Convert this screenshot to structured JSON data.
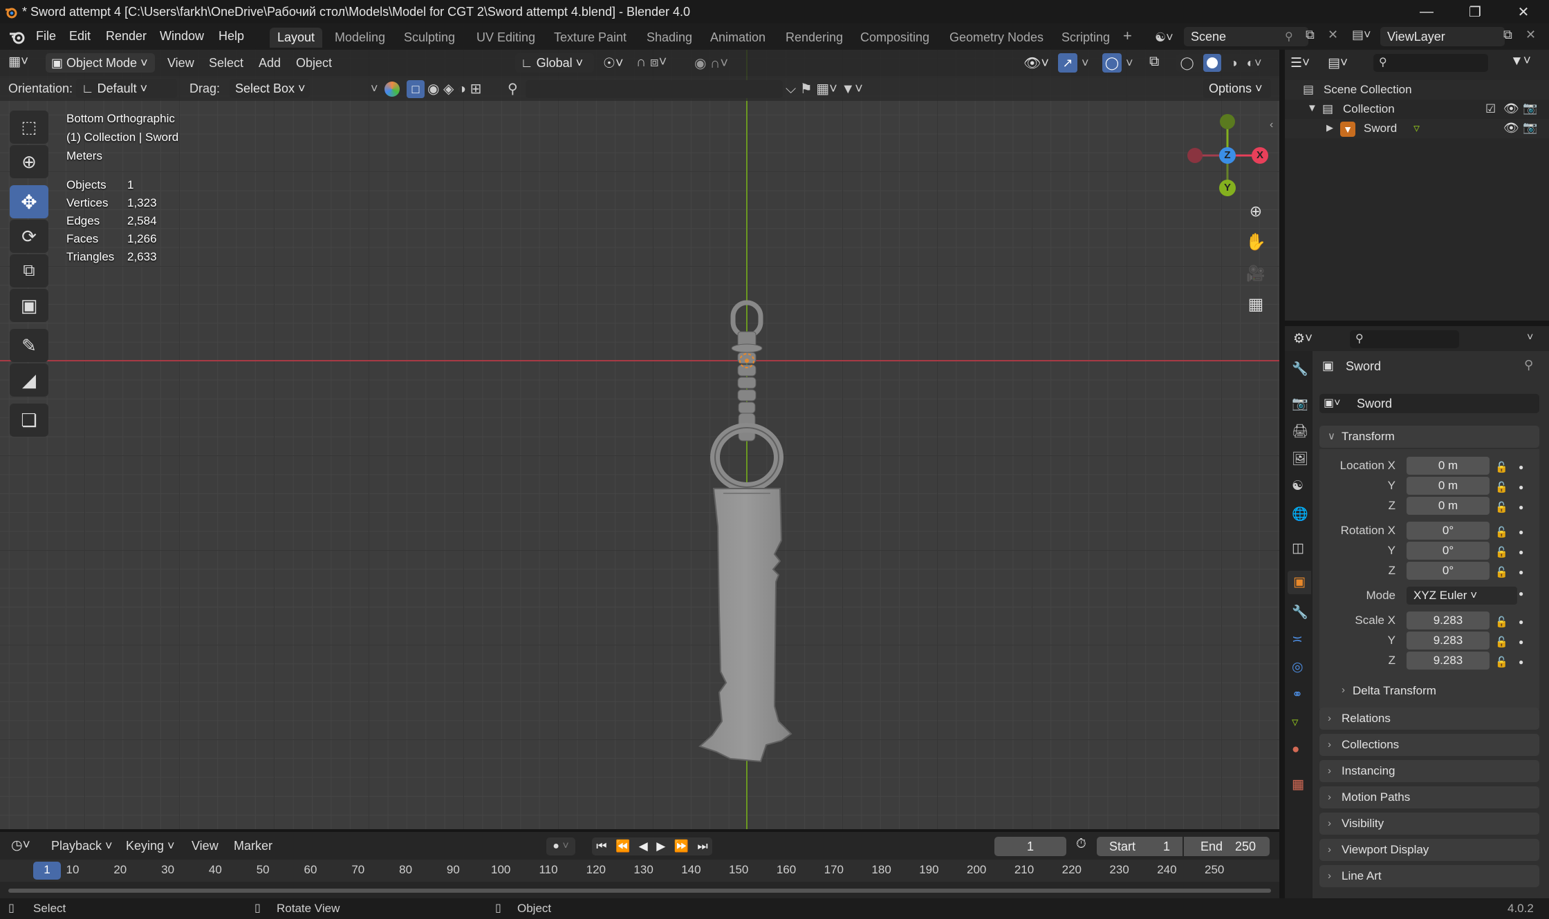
{
  "title_bar": {
    "title": "* Sword attempt 4 [C:\\Users\\farkh\\OneDrive\\Рабочий стол\\Models\\Model for CGT 2\\Sword attempt 4.blend] - Blender 4.0"
  },
  "menu": {
    "file": "File",
    "edit": "Edit",
    "render": "Render",
    "window": "Window",
    "help": "Help"
  },
  "workspaces": [
    "Layout",
    "Modeling",
    "Sculpting",
    "UV Editing",
    "Texture Paint",
    "Shading",
    "Animation",
    "Rendering",
    "Compositing",
    "Geometry Nodes",
    "Scripting"
  ],
  "active_workspace": "Layout",
  "scene": {
    "name": "Scene",
    "view_layer": "ViewLayer"
  },
  "viewport_header": {
    "mode": "Object Mode",
    "view": "View",
    "select": "Select",
    "add": "Add",
    "object": "Object",
    "transform_orientation": "Global"
  },
  "tool_header": {
    "orientation_label": "Orientation:",
    "orientation_value": "Default",
    "drag_label": "Drag:",
    "drag_value": "Select Box",
    "options": "Options"
  },
  "overlay_text": {
    "view_name": "Bottom Orthographic",
    "collection_info": "(1) Collection | Sword",
    "units": "Meters"
  },
  "stats": [
    {
      "label": "Objects",
      "value": "1"
    },
    {
      "label": "Vertices",
      "value": "1,323"
    },
    {
      "label": "Edges",
      "value": "2,584"
    },
    {
      "label": "Faces",
      "value": "1,266"
    },
    {
      "label": "Triangles",
      "value": "2,633"
    }
  ],
  "gizmo": {
    "x": "X",
    "y": "Y",
    "z": "Z"
  },
  "outliner": {
    "root": "Scene Collection",
    "collection": "Collection",
    "object": "Sword"
  },
  "properties": {
    "object_name": "Sword",
    "data_name": "Sword",
    "transform_title": "Transform",
    "location": {
      "label": "Location X",
      "x": "0 m",
      "y": "0 m",
      "z": "0 m"
    },
    "rotation": {
      "label": "Rotation X",
      "x": "0°",
      "y": "0°",
      "z": "0°"
    },
    "mode": {
      "label": "Mode",
      "value": "XYZ Euler"
    },
    "scale": {
      "label": "Scale X",
      "x": "9.283",
      "y": "9.283",
      "z": "9.283"
    },
    "axis_y": "Y",
    "axis_z": "Z",
    "delta_transform": "Delta Transform",
    "panels": [
      "Relations",
      "Collections",
      "Instancing",
      "Motion Paths",
      "Visibility",
      "Viewport Display",
      "Line Art"
    ]
  },
  "timeline": {
    "playback": "Playback",
    "keying": "Keying",
    "view": "View",
    "marker": "Marker",
    "current_frame": "1",
    "start_label": "Start",
    "start": "1",
    "end_label": "End",
    "end": "250",
    "ruler": [
      "1",
      "10",
      "20",
      "30",
      "40",
      "50",
      "60",
      "70",
      "80",
      "90",
      "100",
      "110",
      "120",
      "130",
      "140",
      "150",
      "160",
      "170",
      "180",
      "190",
      "200",
      "210",
      "220",
      "230",
      "240",
      "250"
    ]
  },
  "status_bar": {
    "select": "Select",
    "rotate_view": "Rotate View",
    "object": "Object",
    "version": "4.0.2"
  },
  "colors": {
    "accent": "#4772b3",
    "x_axis": "#e8405a",
    "y_axis": "#84b01f",
    "z_axis": "#3b8ee6",
    "orange": "#e8892b"
  }
}
